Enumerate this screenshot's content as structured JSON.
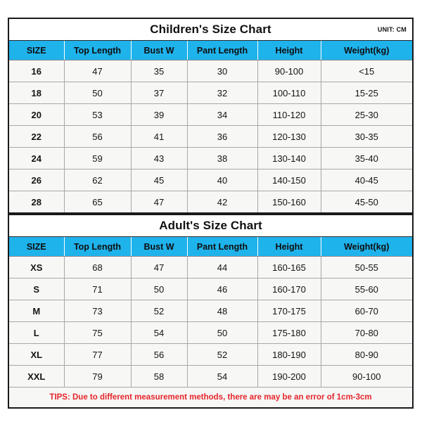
{
  "document": {
    "unit_label": "UNIT: CM",
    "accent_color": "#1fb3ec",
    "tips_color": "#e4252b",
    "cell_background": "#f7f7f5",
    "border_color": "#1a1a1a"
  },
  "children_chart": {
    "title": "Children's Size Chart",
    "unit": "UNIT: CM",
    "columns": [
      "SIZE",
      "Top Length",
      "Bust W",
      "Pant Length",
      "Height",
      "Weight(kg)"
    ],
    "rows": [
      [
        "16",
        "47",
        "35",
        "30",
        "90-100",
        "<15"
      ],
      [
        "18",
        "50",
        "37",
        "32",
        "100-110",
        "15-25"
      ],
      [
        "20",
        "53",
        "39",
        "34",
        "110-120",
        "25-30"
      ],
      [
        "22",
        "56",
        "41",
        "36",
        "120-130",
        "30-35"
      ],
      [
        "24",
        "59",
        "43",
        "38",
        "130-140",
        "35-40"
      ],
      [
        "26",
        "62",
        "45",
        "40",
        "140-150",
        "40-45"
      ],
      [
        "28",
        "65",
        "47",
        "42",
        "150-160",
        "45-50"
      ]
    ]
  },
  "adult_chart": {
    "title": "Adult's Size Chart",
    "columns": [
      "SIZE",
      "Top Length",
      "Bust W",
      "Pant Length",
      "Height",
      "Weight(kg)"
    ],
    "rows": [
      [
        "XS",
        "68",
        "47",
        "44",
        "160-165",
        "50-55"
      ],
      [
        "S",
        "71",
        "50",
        "46",
        "160-170",
        "55-60"
      ],
      [
        "M",
        "73",
        "52",
        "48",
        "170-175",
        "60-70"
      ],
      [
        "L",
        "75",
        "54",
        "50",
        "175-180",
        "70-80"
      ],
      [
        "XL",
        "77",
        "56",
        "52",
        "180-190",
        "80-90"
      ],
      [
        "XXL",
        "79",
        "58",
        "54",
        "190-200",
        "90-100"
      ]
    ],
    "tips": "TIPS: Due to different measurement methods, there are may be an error of 1cm-3cm"
  }
}
